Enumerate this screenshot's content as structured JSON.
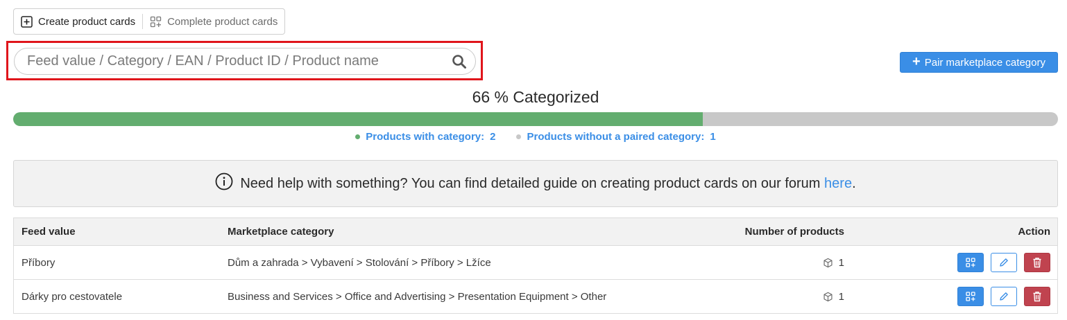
{
  "toolbar": {
    "create_label": "Create product cards",
    "complete_label": "Complete product cards"
  },
  "search": {
    "placeholder": "Feed value / Category / EAN / Product ID / Product name",
    "value": ""
  },
  "pair_button": {
    "label": "Pair marketplace category"
  },
  "progress": {
    "title": "66 % Categorized",
    "percent": 66,
    "with_category_label": "Products with category:",
    "with_category_count": "2",
    "without_category_label": "Products without a paired category:",
    "without_category_count": "1"
  },
  "colors": {
    "accent": "#3a8ee6",
    "progress_fill": "#63ad6f",
    "progress_track": "#c8c8c8",
    "danger": "#c0434f",
    "highlight": "#e0151b"
  },
  "info": {
    "text": "Need help with something? You can find detailed guide on creating product cards on our forum",
    "link_text": "here",
    "suffix": "."
  },
  "table": {
    "headers": {
      "feed_value": "Feed value",
      "marketplace_category": "Marketplace category",
      "number_of_products": "Number of products",
      "action": "Action"
    },
    "rows": [
      {
        "feed_value": "Příbory",
        "marketplace_category": "Dům a zahrada > Vybavení > Stolování > Příbory > Lžíce",
        "number_of_products": "1"
      },
      {
        "feed_value": "Dárky pro cestovatele",
        "marketplace_category": "Business and Services > Office and Advertising > Presentation Equipment > Other",
        "number_of_products": "1"
      }
    ]
  },
  "icons": {
    "create": "plus-square-icon",
    "complete": "grid-add-icon",
    "search": "search-icon",
    "info": "info-circle-icon",
    "product": "box-icon",
    "row_add": "grid-add-icon",
    "row_edit": "pencil-icon",
    "row_delete": "trash-icon"
  }
}
